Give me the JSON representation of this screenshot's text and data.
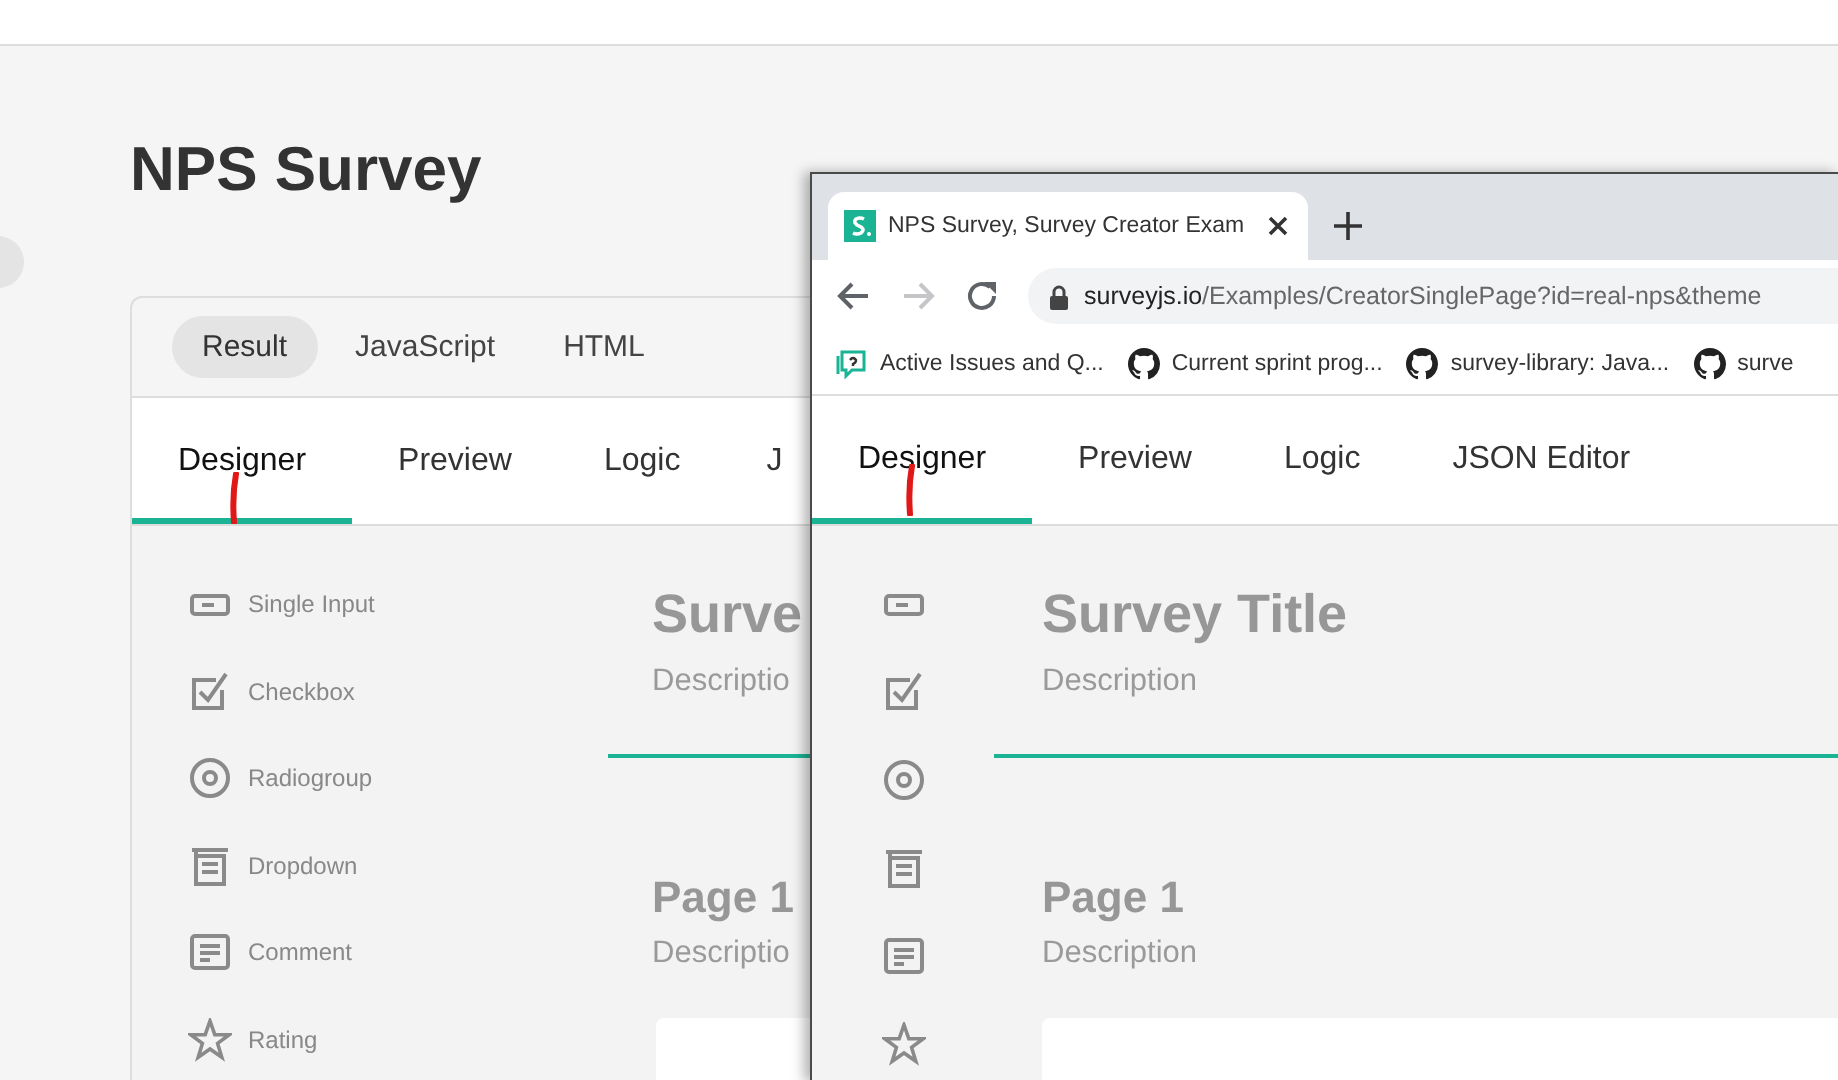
{
  "page": {
    "title": "NPS Survey"
  },
  "code_tabs": [
    {
      "label": "Result",
      "selected": true
    },
    {
      "label": "JavaScript",
      "selected": false
    },
    {
      "label": "HTML",
      "selected": false
    }
  ],
  "creator_tabs": [
    {
      "label": "Designer",
      "selected": true
    },
    {
      "label": "Preview",
      "selected": false
    },
    {
      "label": "Logic",
      "selected": false
    },
    {
      "label": "J",
      "selected": false
    }
  ],
  "toolbox": [
    {
      "label": "Single Input",
      "kind": "text"
    },
    {
      "label": "Checkbox",
      "kind": "checkbox"
    },
    {
      "label": "Radiogroup",
      "kind": "radiogroup"
    },
    {
      "label": "Dropdown",
      "kind": "dropdown"
    },
    {
      "label": "Comment",
      "kind": "comment"
    },
    {
      "label": "Rating",
      "kind": "rating"
    }
  ],
  "survey": {
    "title": "Surve",
    "description": "Descriptio",
    "page_title": "Page 1",
    "page_description": "Descriptio"
  },
  "browser": {
    "tab_title": "NPS Survey, Survey Creator Exam",
    "url_host": "surveyjs.io",
    "url_path": "/Examples/CreatorSinglePage?id=real-nps&theme",
    "forward_disabled": true,
    "bookmarks": [
      {
        "label": "Active Issues and Q...",
        "kind": "issues"
      },
      {
        "label": "Current sprint prog...",
        "kind": "github"
      },
      {
        "label": "survey-library: Java...",
        "kind": "github"
      },
      {
        "label": "surve",
        "kind": "github"
      }
    ],
    "creator_tabs": [
      {
        "label": "Designer",
        "selected": true
      },
      {
        "label": "Preview",
        "selected": false
      },
      {
        "label": "Logic",
        "selected": false
      },
      {
        "label": "JSON Editor",
        "selected": false
      }
    ],
    "toolbox": [
      {
        "kind": "text"
      },
      {
        "kind": "checkbox"
      },
      {
        "kind": "radiogroup"
      },
      {
        "kind": "dropdown"
      },
      {
        "kind": "comment"
      },
      {
        "kind": "rating"
      }
    ],
    "survey": {
      "title": "Survey Title",
      "description": "Description",
      "page_title": "Page 1",
      "page_description": "Description"
    }
  }
}
